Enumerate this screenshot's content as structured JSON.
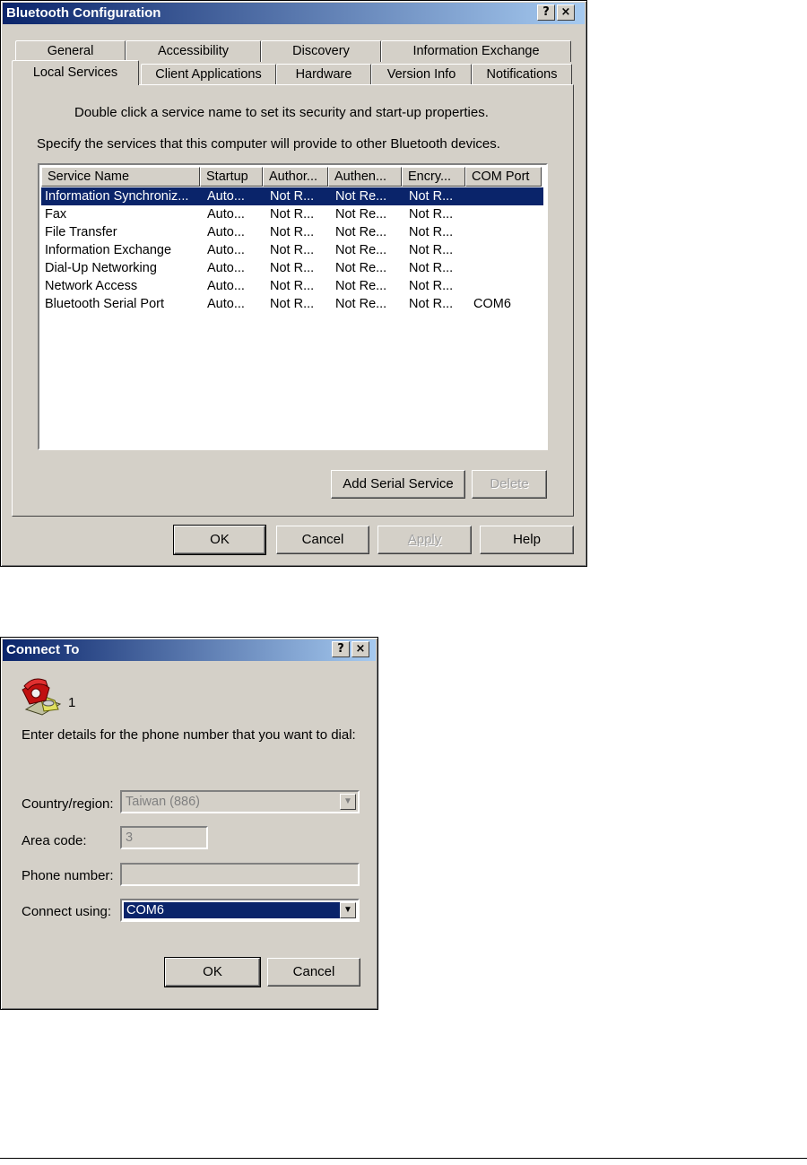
{
  "bt": {
    "title": "Bluetooth Configuration",
    "help_btn": "?",
    "close_btn": "×",
    "tabs_top": [
      "General",
      "Accessibility",
      "Discovery",
      "Information Exchange"
    ],
    "tabs_bottom": [
      "Local Services",
      "Client Applications",
      "Hardware",
      "Version Info",
      "Notifications"
    ],
    "instruction1": "Double click a service name to set its security and start-up properties.",
    "instruction2": "Specify the services that this computer will provide to other Bluetooth devices.",
    "columns": [
      "Service Name",
      "Startup",
      "Author...",
      "Authen...",
      "Encry...",
      "COM Port"
    ],
    "rows": [
      [
        "Information Synchroniz...",
        "Auto...",
        "Not R...",
        "Not Re...",
        "Not R...",
        ""
      ],
      [
        "Fax",
        "Auto...",
        "Not R...",
        "Not Re...",
        "Not R...",
        ""
      ],
      [
        "File Transfer",
        "Auto...",
        "Not R...",
        "Not Re...",
        "Not R...",
        ""
      ],
      [
        "Information Exchange",
        "Auto...",
        "Not R...",
        "Not Re...",
        "Not R...",
        ""
      ],
      [
        "Dial-Up Networking",
        "Auto...",
        "Not R...",
        "Not Re...",
        "Not R...",
        ""
      ],
      [
        "Network Access",
        "Auto...",
        "Not R...",
        "Not Re...",
        "Not R...",
        ""
      ],
      [
        "Bluetooth Serial Port",
        "Auto...",
        "Not R...",
        "Not Re...",
        "Not R...",
        "COM6"
      ]
    ],
    "add_serial": "Add Serial Service",
    "delete": "Delete",
    "ok": "OK",
    "cancel": "Cancel",
    "apply": "Apply",
    "help": "Help"
  },
  "ct": {
    "title": "Connect To",
    "help_btn": "?",
    "close_btn": "×",
    "connection_name": "1",
    "prompt": "Enter details for the phone number that you want to dial:",
    "country_label": "Country/region:",
    "country_value": "Taiwan (886)",
    "area_label": "Area code:",
    "area_value": "3",
    "phone_label": "Phone number:",
    "phone_value": "",
    "connect_label": "Connect using:",
    "connect_value": "COM6",
    "ok": "OK",
    "cancel": "Cancel"
  }
}
